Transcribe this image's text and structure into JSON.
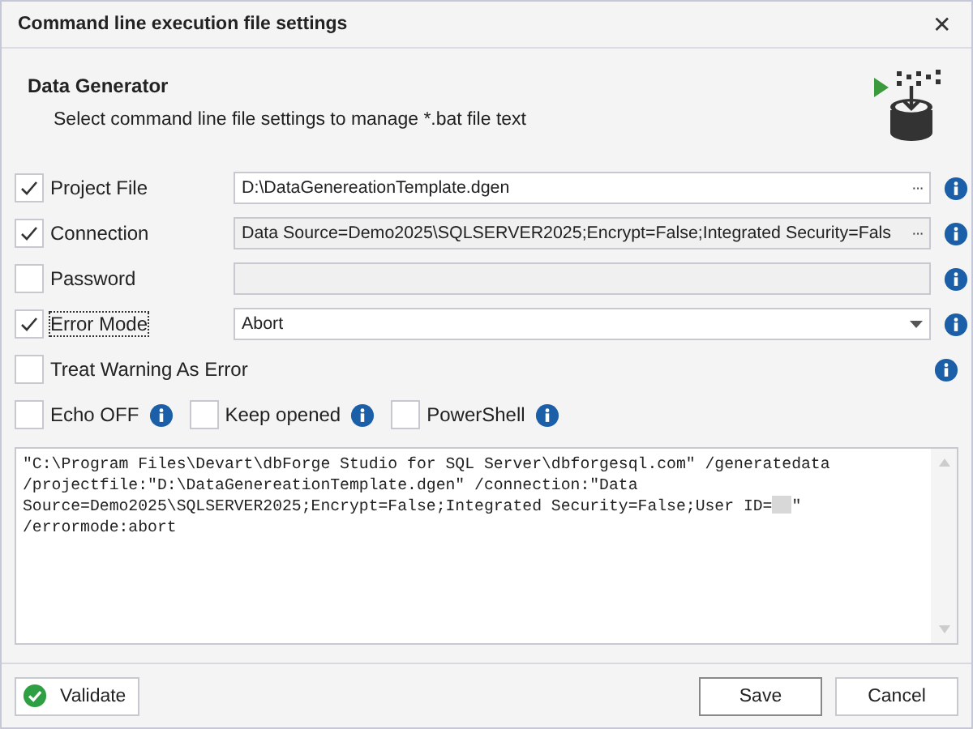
{
  "window": {
    "title": "Command line execution file settings",
    "close": "✕"
  },
  "header": {
    "title": "Data Generator",
    "subtitle": "Select command line file settings to manage *.bat file text"
  },
  "settings": [
    {
      "label": "Project File",
      "checked": true,
      "kind": "browse",
      "browse": "···",
      "value": "D:\\DataGenereationTemplate.dgen",
      "editable": true,
      "focused": false
    },
    {
      "label": "Connection",
      "checked": true,
      "kind": "browse",
      "browse": "···",
      "value": "Data Source=Demo2025\\SQLSERVER2025;Encrypt=False;Integrated Security=Fals",
      "editable": false,
      "focused": false
    },
    {
      "label": "Password",
      "checked": false,
      "kind": "text",
      "editable": false,
      "focused": false
    },
    {
      "label": "Error Mode",
      "checked": true,
      "kind": "dropdown",
      "value": "Abort",
      "editable": true,
      "focused": true
    },
    {
      "label": "Treat Warning As Error",
      "checked": false,
      "kind": "none",
      "focused": false
    }
  ],
  "options": [
    {
      "label": "Echo OFF",
      "checked": false
    },
    {
      "label": "Keep opened",
      "checked": false
    },
    {
      "label": "PowerShell",
      "checked": false
    }
  ],
  "command": {
    "text": "\"C:\\Program Files\\Devart\\dbForge Studio for SQL Server\\dbforgesql.com\" /generatedata /projectfile:\"D:\\DataGenereationTemplate.dgen\" /connection:\"Data Source=Demo2025\\SQLSERVER2025;Encrypt=False;Integrated Security=False;User ID=",
    "redacted": true,
    "text_end": "\" /errormode:abort"
  },
  "buttons": {
    "validate": "Validate",
    "save": "Save",
    "cancel": "Cancel"
  }
}
